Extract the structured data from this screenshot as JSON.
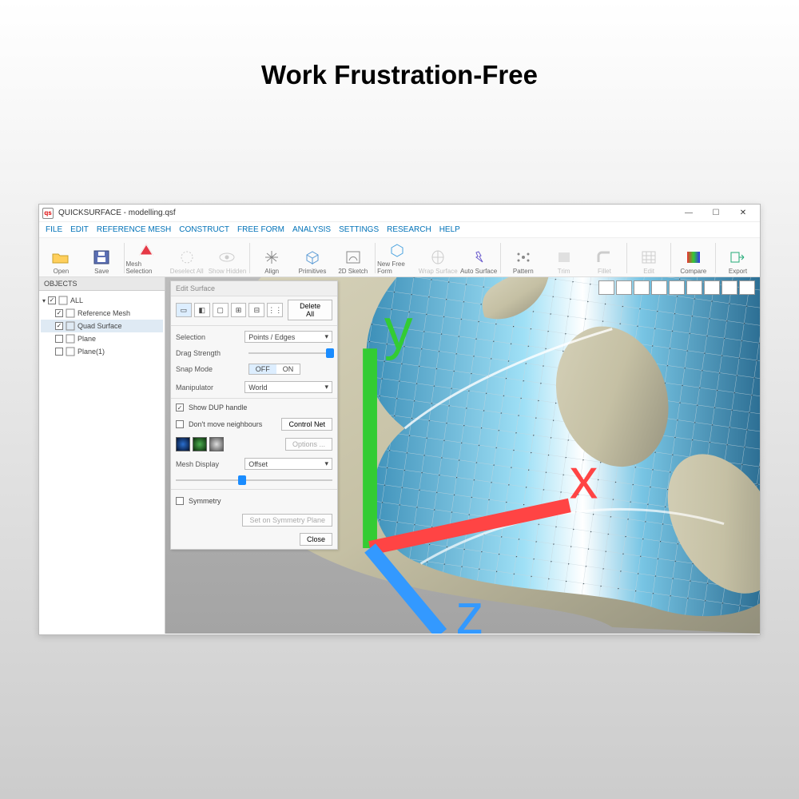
{
  "headline": "Work Frustration-Free",
  "window": {
    "title": "QUICKSURFACE - modelling.qsf",
    "icon_text": "qs",
    "controls": {
      "min": "—",
      "max": "☐",
      "close": "✕"
    }
  },
  "menubar": [
    "FILE",
    "EDIT",
    "REFERENCE MESH",
    "CONSTRUCT",
    "FREE FORM",
    "ANALYSIS",
    "SETTINGS",
    "RESEARCH",
    "HELP"
  ],
  "toolbar": [
    {
      "label": "Open",
      "group": 0
    },
    {
      "label": "Save",
      "group": 0
    },
    {
      "label": "Mesh Selection",
      "group": 1
    },
    {
      "label": "Deselect All",
      "group": 1,
      "disabled": true
    },
    {
      "label": "Show Hidden",
      "group": 1,
      "disabled": true
    },
    {
      "label": "Align",
      "group": 2
    },
    {
      "label": "Primitives",
      "group": 2
    },
    {
      "label": "2D Sketch",
      "group": 2
    },
    {
      "label": "New Free Form",
      "group": 3
    },
    {
      "label": "Wrap Surface",
      "group": 3,
      "disabled": true
    },
    {
      "label": "Auto Surface",
      "group": 3
    },
    {
      "label": "Pattern",
      "group": 4
    },
    {
      "label": "Trim",
      "group": 4,
      "disabled": true
    },
    {
      "label": "Fillet",
      "group": 4,
      "disabled": true
    },
    {
      "label": "Edit",
      "group": 5,
      "disabled": true
    },
    {
      "label": "Compare",
      "group": 6
    },
    {
      "label": "Export",
      "group": 7
    }
  ],
  "objects": {
    "header": "OBJECTS",
    "root": "ALL",
    "items": [
      {
        "label": "Reference Mesh",
        "checked": true
      },
      {
        "label": "Quad Surface",
        "checked": true,
        "selected": true
      },
      {
        "label": "Plane",
        "checked": false
      },
      {
        "label": "Plane(1)",
        "checked": false
      }
    ]
  },
  "panel": {
    "title": "Edit Surface",
    "delete_all": "Delete All",
    "selection_label": "Selection",
    "selection_value": "Points / Edges",
    "drag_label": "Drag Strength",
    "drag_value_pct": 92,
    "snap_label": "Snap Mode",
    "snap_off": "OFF",
    "snap_on": "ON",
    "snap_active": "OFF",
    "manip_label": "Manipulator",
    "manip_value": "World",
    "dup_label": "Show DUP handle",
    "dup_checked": true,
    "neigh_label": "Don't move neighbours",
    "neigh_checked": false,
    "control_net": "Control Net",
    "options": "Options ...",
    "mesh_display_label": "Mesh Display",
    "mesh_display_value": "Offset",
    "mesh_slider_pct": 40,
    "symmetry_label": "Symmetry",
    "symmetry_checked": false,
    "set_symmetry": "Set on Symmetry Plane",
    "close": "Close"
  },
  "axis": {
    "x": "x",
    "y": "y",
    "z": "z"
  }
}
